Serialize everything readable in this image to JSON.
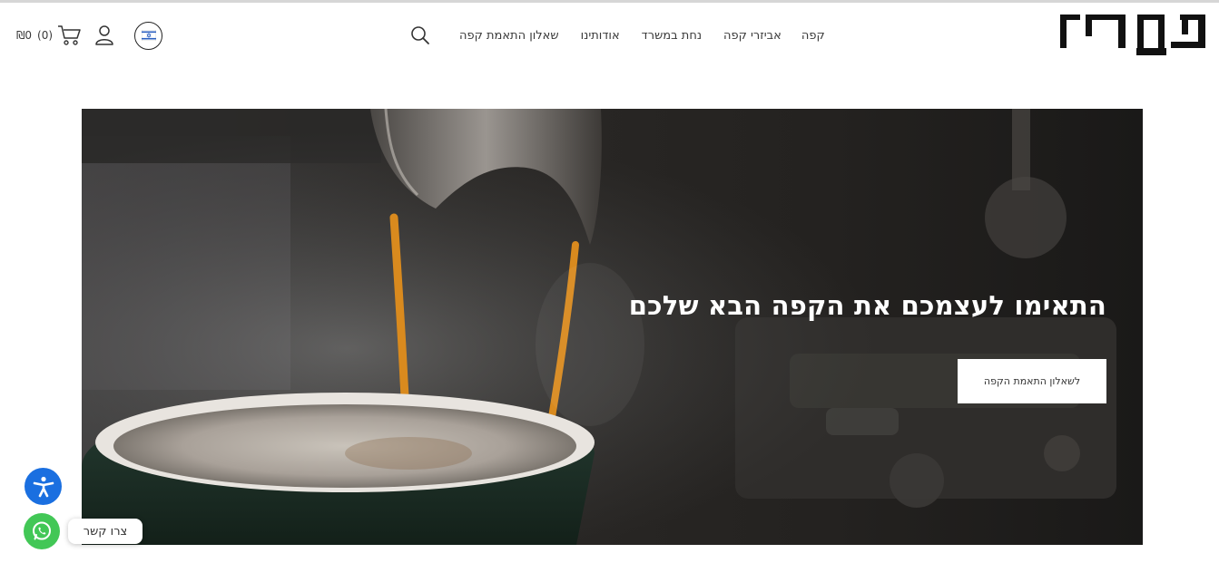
{
  "header": {
    "nav": [
      {
        "label": "קפה"
      },
      {
        "label": "אביזרי קפה"
      },
      {
        "label": "נחת במשרד"
      },
      {
        "label": "אודותינו"
      },
      {
        "label": "שאלון התאמת קפה"
      }
    ],
    "cart": {
      "count": "(0)",
      "currency": "₪0"
    },
    "icons": {
      "search": "search-icon",
      "cart": "cart-icon",
      "user": "user-icon",
      "language": "israel-flag-icon"
    }
  },
  "hero": {
    "title": "התאימו לעצמכם את הקפה הבא שלכם",
    "button_label": "לשאלון התאמת הקפה"
  },
  "floating": {
    "whatsapp_label": "צרו קשר",
    "accessibility_icon": "accessibility-icon",
    "whatsapp_icon": "whatsapp-icon"
  },
  "colors": {
    "accessibility": "#1a6fe0",
    "whatsapp": "#42c756",
    "espresso": "#d98a1e"
  }
}
